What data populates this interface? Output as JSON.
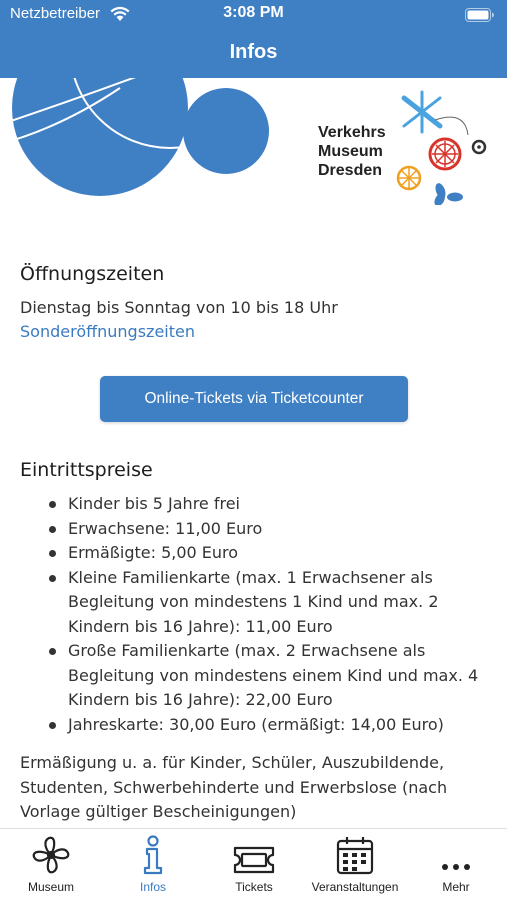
{
  "status": {
    "carrier": "Netzbetreiber",
    "time": "3:08 PM"
  },
  "nav": {
    "title": "Infos"
  },
  "logo": {
    "line1": "Verkehrs",
    "line2": "Museum",
    "line3": "Dresden"
  },
  "opening": {
    "heading": "Öffnungszeiten",
    "hours": "Dienstag bis Sonntag von 10 bis 18 Uhr",
    "special_link": "Sonderöffnungszeiten"
  },
  "tickets_button": "Online-Tickets via Ticketcounter",
  "prices": {
    "heading": "Eintrittspreise",
    "items": [
      "Kinder bis 5 Jahre frei",
      "Erwachsene: 11,00 Euro",
      "Ermäßigte: 5,00 Euro",
      "Kleine Familienkarte (max. 1 Erwachsener als Begleitung von mindestens 1 Kind und max. 2 Kindern bis 16 Jahre): 11,00 Euro",
      "Große Familienkarte (max. 2 Erwachsene als Begleitung von mindestens einem Kind und max. 4 Kindern bis 16 Jahre): 22,00 Euro",
      "Jahreskarte: 30,00 Euro (ermäßigt: 14,00 Euro)"
    ],
    "note": "Ermäßigung u. a. für Kinder, Schüler, Auszubildende, Studenten, Schwerbehinderte und Erwerbslose (nach Vorlage gültiger Bescheinigungen)"
  },
  "tabs": [
    {
      "label": "Museum",
      "icon": "propeller-icon",
      "active": false
    },
    {
      "label": "Infos",
      "icon": "info-icon",
      "active": true
    },
    {
      "label": "Tickets",
      "icon": "ticket-icon",
      "active": false
    },
    {
      "label": "Veranstaltungen",
      "icon": "calendar-icon",
      "active": false
    },
    {
      "label": "Mehr",
      "icon": "more-dots-icon",
      "active": false
    }
  ],
  "colors": {
    "accent": "#3f7fc4",
    "link": "#3a7bc0",
    "logo_red": "#d9342b",
    "logo_orange": "#f0a020",
    "logo_lightblue": "#4aa3df"
  }
}
